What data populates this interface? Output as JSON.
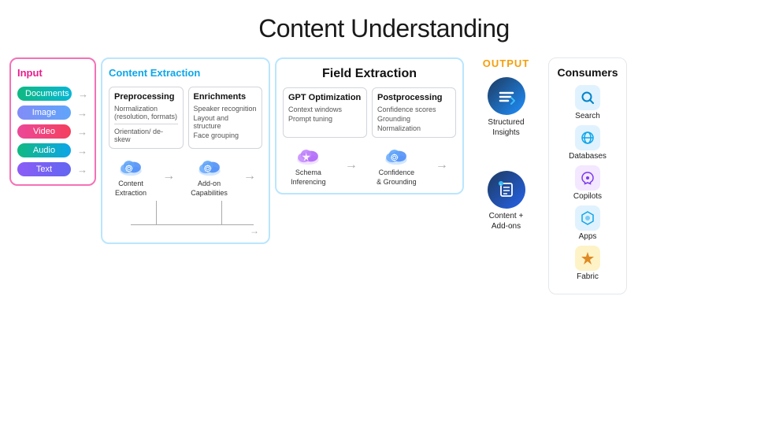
{
  "page": {
    "title": "Content Understanding"
  },
  "input": {
    "section_title": "Input",
    "items": [
      {
        "label": "Documents",
        "badge_class": "badge-docs"
      },
      {
        "label": "Image",
        "badge_class": "badge-image"
      },
      {
        "label": "Video",
        "badge_class": "badge-video"
      },
      {
        "label": "Audio",
        "badge_class": "badge-audio"
      },
      {
        "label": "Text",
        "badge_class": "badge-text"
      }
    ]
  },
  "content_extraction": {
    "section_title": "Content Extraction",
    "preprocessing": {
      "title": "Preprocessing",
      "line1": "Normalization (resolution, formats)",
      "divider": true,
      "line2": "Orientation/ de-skew"
    },
    "enrichments": {
      "title": "Enrichments",
      "line1": "Speaker recognition",
      "line2": "Layout and structure",
      "line3": "Face grouping"
    },
    "cloud1_label": "Content\nExtraction",
    "cloud2_label": "Add-on\nCapabilities"
  },
  "field_extraction": {
    "section_title": "Field Extraction",
    "gpt": {
      "title": "GPT Optimization",
      "line1": "Context windows",
      "line2": "Prompt tuning"
    },
    "postprocessing": {
      "title": "Postprocessing",
      "line1": "Confidence scores",
      "line2": "Grounding",
      "line3": "Normalization"
    },
    "cloud1_label": "Schema\nInferencing",
    "cloud2_label": "Confidence\n& Grounding"
  },
  "output": {
    "section_title": "OUTPUT",
    "structured": {
      "label_line1": "Structured",
      "label_line2": "Insights"
    },
    "content": {
      "label_line1": "Content +",
      "label_line2": "Add-ons"
    }
  },
  "consumers": {
    "section_title": "Consumers",
    "items": [
      {
        "label": "Search",
        "icon": "🔍",
        "icon_class": "icon-search"
      },
      {
        "label": "Databases",
        "icon": "🌐",
        "icon_class": "icon-db"
      },
      {
        "label": "Copilots",
        "icon": "✦",
        "icon_class": "icon-copilot"
      },
      {
        "label": "Apps",
        "icon": "⬡",
        "icon_class": "icon-apps"
      },
      {
        "label": "Fabric",
        "icon": "⚡",
        "icon_class": "icon-fabric"
      }
    ]
  }
}
